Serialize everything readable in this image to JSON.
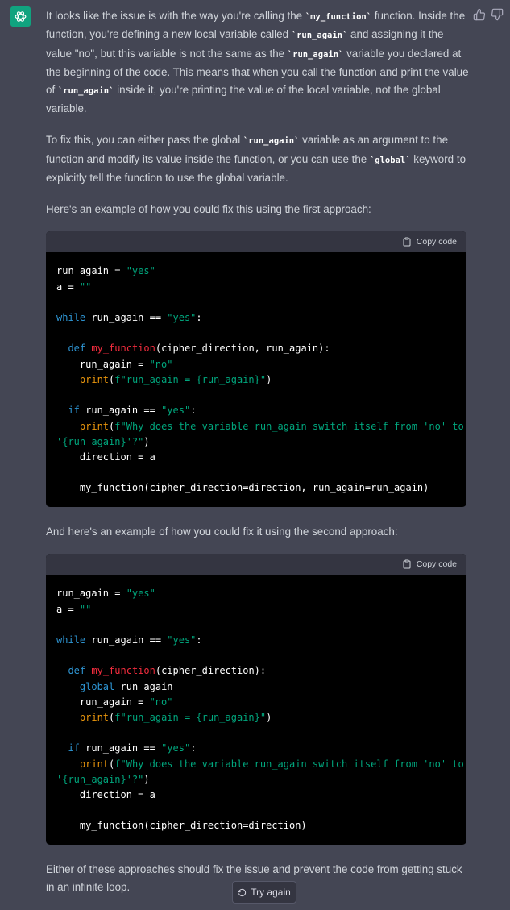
{
  "message": {
    "p1": {
      "t1": "It looks like the issue is with the way you're calling the ",
      "c1": "`my_function`",
      "t2": " function. Inside the function, you're defining a new local variable called ",
      "c2": "`run_again`",
      "t3": " and assigning it the value \"no\", but this variable is not the same as the ",
      "c3": "`run_again`",
      "t4": " variable you declared at the beginning of the code. This means that when you call the function and print the value of ",
      "c4": "`run_again`",
      "t5": " inside it, you're printing the value of the local variable, not the global variable."
    },
    "p2": {
      "t1": "To fix this, you can either pass the global ",
      "c1": "`run_again`",
      "t2": " variable as an argument to the function and modify its value inside the function, or you can use the ",
      "c2": "`global`",
      "t3": " keyword to explicitly tell the function to use the global variable."
    },
    "p3": "Here's an example of how you could fix this using the first approach:",
    "p4": "And here's an example of how you could fix it using the second approach:",
    "p5": "Either of these approaches should fix the issue and prevent the code from getting stuck in an infinite loop."
  },
  "code_blocks": [
    {
      "copy_label": "Copy code",
      "lines": [
        [
          {
            "t": "run_again = "
          },
          {
            "t": "\"yes\"",
            "c": "s"
          }
        ],
        [
          {
            "t": "a = "
          },
          {
            "t": "\"\"",
            "c": "s"
          }
        ],
        [],
        [
          {
            "t": "while",
            "c": "k"
          },
          {
            "t": " run_again == "
          },
          {
            "t": "\"yes\"",
            "c": "s"
          },
          {
            "t": ":"
          }
        ],
        [],
        [
          {
            "t": "  "
          },
          {
            "t": "def",
            "c": "k"
          },
          {
            "t": " "
          },
          {
            "t": "my_function",
            "c": "f"
          },
          {
            "t": "(cipher_direction, run_again):"
          }
        ],
        [
          {
            "t": "    run_again = "
          },
          {
            "t": "\"no\"",
            "c": "s"
          }
        ],
        [
          {
            "t": "    "
          },
          {
            "t": "print",
            "c": "b"
          },
          {
            "t": "("
          },
          {
            "t": "f\"run_again = {run_again}\"",
            "c": "s"
          },
          {
            "t": ")"
          }
        ],
        [],
        [
          {
            "t": "  "
          },
          {
            "t": "if",
            "c": "k"
          },
          {
            "t": " run_again == "
          },
          {
            "t": "\"yes\"",
            "c": "s"
          },
          {
            "t": ":"
          }
        ],
        [
          {
            "t": "    "
          },
          {
            "t": "print",
            "c": "b"
          },
          {
            "t": "("
          },
          {
            "t": "f\"Why does the variable run_again switch itself from 'no' to",
            "c": "s"
          }
        ],
        [
          {
            "t": "'{run_again}'?\"",
            "c": "s"
          },
          {
            "t": ")"
          }
        ],
        [
          {
            "t": "    direction = a"
          }
        ],
        [],
        [
          {
            "t": "    my_function(cipher_direction=direction, run_again=run_again)"
          }
        ]
      ]
    },
    {
      "copy_label": "Copy code",
      "lines": [
        [
          {
            "t": "run_again = "
          },
          {
            "t": "\"yes\"",
            "c": "s"
          }
        ],
        [
          {
            "t": "a = "
          },
          {
            "t": "\"\"",
            "c": "s"
          }
        ],
        [],
        [
          {
            "t": "while",
            "c": "k"
          },
          {
            "t": " run_again == "
          },
          {
            "t": "\"yes\"",
            "c": "s"
          },
          {
            "t": ":"
          }
        ],
        [],
        [
          {
            "t": "  "
          },
          {
            "t": "def",
            "c": "k"
          },
          {
            "t": " "
          },
          {
            "t": "my_function",
            "c": "f"
          },
          {
            "t": "(cipher_direction):"
          }
        ],
        [
          {
            "t": "    "
          },
          {
            "t": "global",
            "c": "k"
          },
          {
            "t": " run_again"
          }
        ],
        [
          {
            "t": "    run_again = "
          },
          {
            "t": "\"no\"",
            "c": "s"
          }
        ],
        [
          {
            "t": "    "
          },
          {
            "t": "print",
            "c": "b"
          },
          {
            "t": "("
          },
          {
            "t": "f\"run_again = {run_again}\"",
            "c": "s"
          },
          {
            "t": ")"
          }
        ],
        [],
        [
          {
            "t": "  "
          },
          {
            "t": "if",
            "c": "k"
          },
          {
            "t": " run_again == "
          },
          {
            "t": "\"yes\"",
            "c": "s"
          },
          {
            "t": ":"
          }
        ],
        [
          {
            "t": "    "
          },
          {
            "t": "print",
            "c": "b"
          },
          {
            "t": "("
          },
          {
            "t": "f\"Why does the variable run_again switch itself from 'no' to",
            "c": "s"
          }
        ],
        [
          {
            "t": "'{run_again}'?\"",
            "c": "s"
          },
          {
            "t": ")"
          }
        ],
        [
          {
            "t": "    direction = a"
          }
        ],
        [],
        [
          {
            "t": "    my_function(cipher_direction=direction)"
          }
        ]
      ]
    }
  ],
  "try_again_label": "Try again",
  "icons": {
    "avatar": "openai-logo-icon",
    "thumbs_up": "thumbs-up-icon",
    "thumbs_down": "thumbs-down-icon",
    "copy": "clipboard-icon",
    "refresh": "refresh-icon"
  },
  "colors": {
    "background": "#444654",
    "text": "#d1d5db",
    "avatar_bg": "#10a37f",
    "code_bg": "#000000",
    "code_header_bg": "#343541",
    "keyword": "#2e95d3",
    "string": "#00a67d",
    "function_name": "#f22c3d",
    "builtin": "#e9950c"
  }
}
